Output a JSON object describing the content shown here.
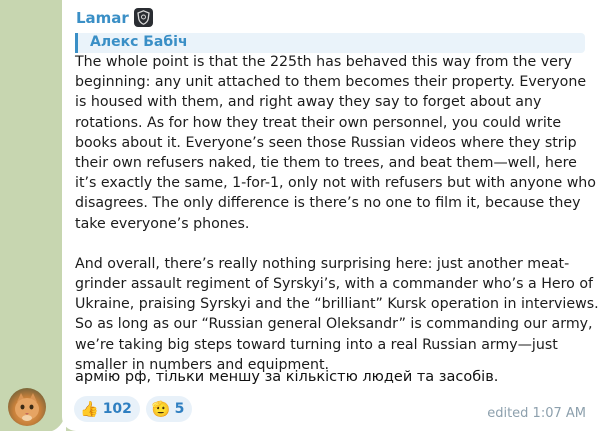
{
  "message": {
    "sender": "Lamar",
    "reply": {
      "author": "Алекс Бабіч"
    },
    "translated_paragraphs": [
      "The whole point is that the 225th has behaved this way from the very beginning: any unit attached to them becomes their property. Everyone is housed with them, and right away they say to forget about any rotations. As for how they treat their own personnel, you could write books about it. Everyone’s seen those Russian videos where they strip their own refusers naked, tie them to trees, and beat them—well, here it’s exactly the same, 1-for-1, only not with refusers but with anyone who disagrees. The only difference is there’s no one to film it, because they take everyone’s phones.",
      "And overall, there’s really nothing surprising here: just another meat-grinder assault regiment of Syrskyi’s, with a commander who’s a Hero of Ukraine, praising Syrskyi and the “brilliant”  Kursk operation in interviews. So as long as our “Russian general Oleksandr” is commanding our army, we’re taking big steps toward turning into a real Russian army—just smaller in numbers and equipment."
    ],
    "original_text": "армію рф, тільки меншу за кількістю людей та засобів.",
    "reactions": [
      {
        "emoji": "👍",
        "count": "102",
        "icon": "thumbs-up-icon"
      },
      {
        "emoji": "🫡",
        "count": "5",
        "icon": "saluting-face-icon"
      }
    ],
    "meta": "edited 1:07 AM"
  },
  "colors": {
    "background": "#c7d6b0",
    "bubble": "#ffffff",
    "accent": "#3a8fc6",
    "reply_background": "#eaf3fa"
  }
}
